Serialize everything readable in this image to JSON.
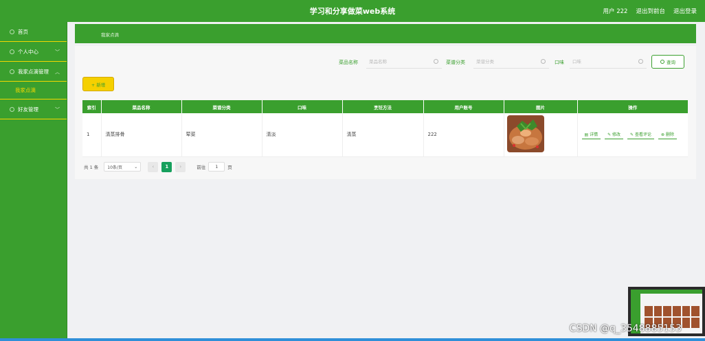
{
  "header": {
    "title": "学习和分享做菜web系统",
    "user_label": "用户 222",
    "back_front": "退出到前台",
    "logout": "退出登录"
  },
  "sidebar": {
    "items": [
      {
        "label": "首页"
      },
      {
        "label": "个人中心"
      },
      {
        "label": "我家点滴管理"
      },
      {
        "label": "我家点滴"
      },
      {
        "label": "好友管理"
      }
    ]
  },
  "breadcrumb": {
    "current": "我家点滴"
  },
  "search": {
    "fields": [
      {
        "label": "菜品名称",
        "placeholder": "菜品名称"
      },
      {
        "label": "菜谱分类",
        "placeholder": "菜谱分类"
      },
      {
        "label": "口味",
        "placeholder": "口味"
      }
    ],
    "query_label": "查询"
  },
  "toolbar": {
    "add_label": "+ 新增"
  },
  "table": {
    "headers": [
      "索引",
      "菜品名称",
      "菜谱分类",
      "口味",
      "烹饪方法",
      "用户账号",
      "图片",
      "操作"
    ],
    "rows": [
      {
        "index": "1",
        "name": "清蒸排骨",
        "category": "荤菜",
        "taste": "清淡",
        "method": "清蒸",
        "account": "222",
        "actions": [
          "详情",
          "修改",
          "查看评论",
          "删除"
        ]
      }
    ]
  },
  "pager": {
    "total": "共 1 条",
    "page_size": "10条/页",
    "current_page": "1",
    "goto_label": "前往",
    "goto_value": "1",
    "page_suffix": "页"
  },
  "watermark": "CSDN @q_3548885153"
}
